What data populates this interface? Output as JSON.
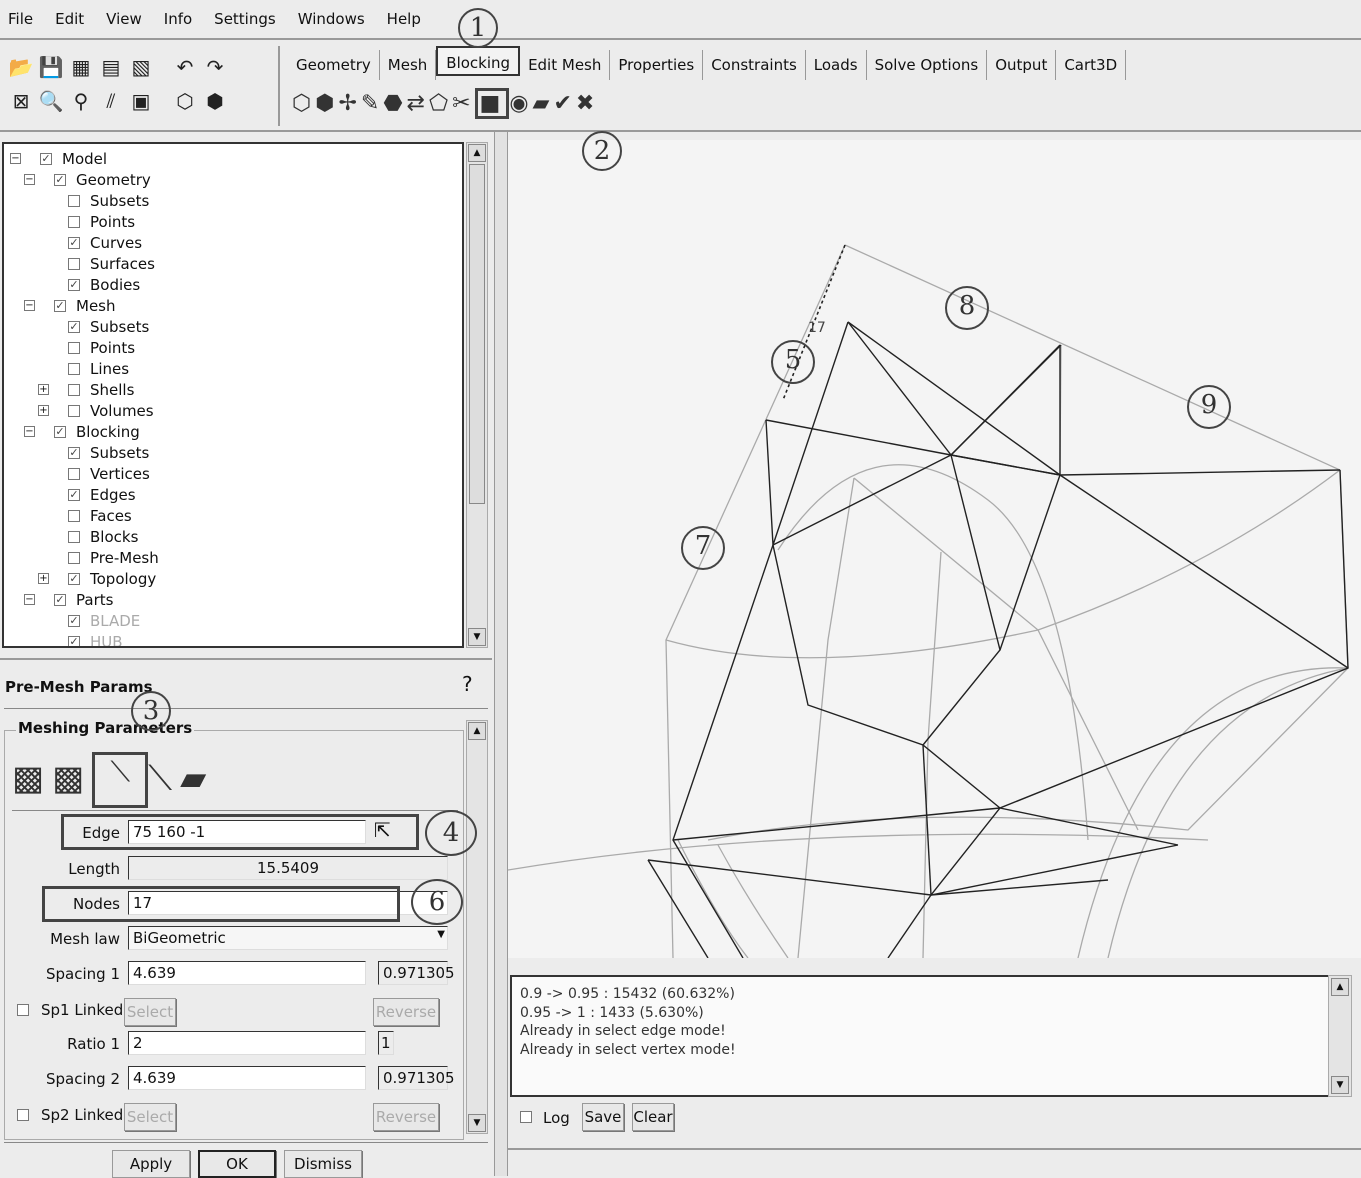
{
  "menu": [
    "File",
    "Edit",
    "View",
    "Info",
    "Settings",
    "Windows",
    "Help"
  ],
  "tabs": [
    "Geometry",
    "Mesh",
    "Blocking",
    "Edit Mesh",
    "Properties",
    "Constraints",
    "Loads",
    "Solve Options",
    "Output",
    "Cart3D"
  ],
  "active_tab": "Blocking",
  "tree": [
    {
      "label": "Model",
      "level": 0,
      "checked": true,
      "expander": "-"
    },
    {
      "label": "Geometry",
      "level": 1,
      "checked": true,
      "expander": "-"
    },
    {
      "label": "Subsets",
      "level": 2,
      "checked": false
    },
    {
      "label": "Points",
      "level": 2,
      "checked": false
    },
    {
      "label": "Curves",
      "level": 2,
      "checked": true
    },
    {
      "label": "Surfaces",
      "level": 2,
      "checked": false
    },
    {
      "label": "Bodies",
      "level": 2,
      "checked": true
    },
    {
      "label": "Mesh",
      "level": 1,
      "checked": true,
      "expander": "-"
    },
    {
      "label": "Subsets",
      "level": 2,
      "checked": true
    },
    {
      "label": "Points",
      "level": 2,
      "checked": false
    },
    {
      "label": "Lines",
      "level": 2,
      "checked": false
    },
    {
      "label": "Shells",
      "level": 2,
      "checked": false,
      "expander": "+"
    },
    {
      "label": "Volumes",
      "level": 2,
      "checked": false,
      "expander": "+"
    },
    {
      "label": "Blocking",
      "level": 1,
      "checked": true,
      "expander": "-"
    },
    {
      "label": "Subsets",
      "level": 2,
      "checked": true
    },
    {
      "label": "Vertices",
      "level": 2,
      "checked": false
    },
    {
      "label": "Edges",
      "level": 2,
      "checked": true
    },
    {
      "label": "Faces",
      "level": 2,
      "checked": false
    },
    {
      "label": "Blocks",
      "level": 2,
      "checked": false
    },
    {
      "label": "Pre-Mesh",
      "level": 2,
      "checked": false
    },
    {
      "label": "Topology",
      "level": 2,
      "checked": true,
      "expander": "+"
    },
    {
      "label": "Parts",
      "level": 1,
      "checked": true,
      "expander": "-"
    },
    {
      "label": "BLADE",
      "level": 2,
      "checked": true,
      "dim": true
    },
    {
      "label": "HUB",
      "level": 2,
      "checked": true,
      "dim": true
    }
  ],
  "params": {
    "title": "Pre-Mesh Params",
    "section": "Meshing Parameters",
    "edge_label": "Edge",
    "edge_value": "75 160 -1",
    "length_label": "Length",
    "length_value": "15.5409",
    "nodes_label": "Nodes",
    "nodes_value": "17",
    "meshlaw_label": "Mesh law",
    "meshlaw_value": "BiGeometric",
    "spacing1_label": "Spacing 1",
    "spacing1_value": "4.639",
    "spacing1_actual": "0.971305",
    "sp1linked_label": "Sp1 Linked",
    "select_label": "Select",
    "reverse_label": "Reverse",
    "ratio1_label": "Ratio 1",
    "ratio1_value": "2",
    "ratio1_actual": "1",
    "spacing2_label": "Spacing 2",
    "spacing2_value": "4.639",
    "spacing2_actual": "0.971305",
    "sp2linked_label": "Sp2 Linked",
    "apply": "Apply",
    "ok": "OK",
    "dismiss": "Dismiss"
  },
  "console": {
    "lines": [
      "0.9 -> 0.95 : 15432 (60.632%)",
      "0.95 -> 1 : 1433 (5.630%)",
      "Already in select edge mode!",
      "Already in select vertex mode!"
    ],
    "log_label": "Log",
    "save_label": "Save",
    "clear_label": "Clear"
  },
  "viewport": {
    "edge_node_label": "17"
  },
  "annotations": [
    "1",
    "2",
    "3",
    "4",
    "5",
    "6",
    "7",
    "8",
    "9"
  ]
}
